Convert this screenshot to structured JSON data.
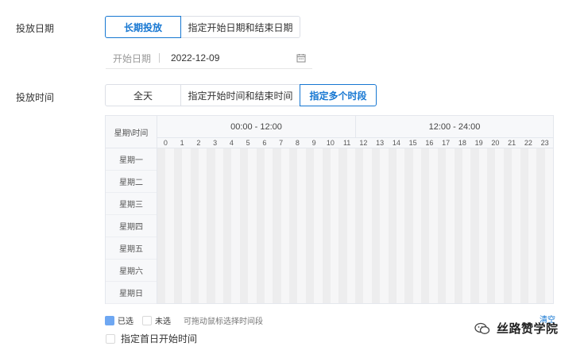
{
  "delivery_date": {
    "label": "投放日期",
    "options": [
      "长期投放",
      "指定开始日期和结束日期"
    ],
    "start_label": "开始日期",
    "start_value": "2022-12-09"
  },
  "delivery_time": {
    "label": "投放时间",
    "options": [
      "全天",
      "指定开始时间和结束时间",
      "指定多个时段"
    ]
  },
  "schedule": {
    "corner": "星期\\时间",
    "first_half": "00:00 - 12:00",
    "second_half": "12:00 - 24:00",
    "hours": [
      "0",
      "1",
      "2",
      "3",
      "4",
      "5",
      "6",
      "7",
      "8",
      "9",
      "10",
      "11",
      "12",
      "13",
      "14",
      "15",
      "16",
      "17",
      "18",
      "19",
      "20",
      "21",
      "22",
      "23"
    ],
    "days": [
      "星期一",
      "星期二",
      "星期三",
      "星期四",
      "星期五",
      "星期六",
      "星期日"
    ]
  },
  "legend": {
    "selected": "已选",
    "unselected": "未选",
    "hint": "可拖动鼠标选择时间段",
    "clear": "清空"
  },
  "first_day_option": "指定首日开始时间",
  "watermark": "丝路赞学院",
  "colors": {
    "accent": "#1677d2",
    "selected_fill": "#6ea7f2",
    "cell_dark": "#ededee",
    "cell_light": "#f6f6f7"
  }
}
